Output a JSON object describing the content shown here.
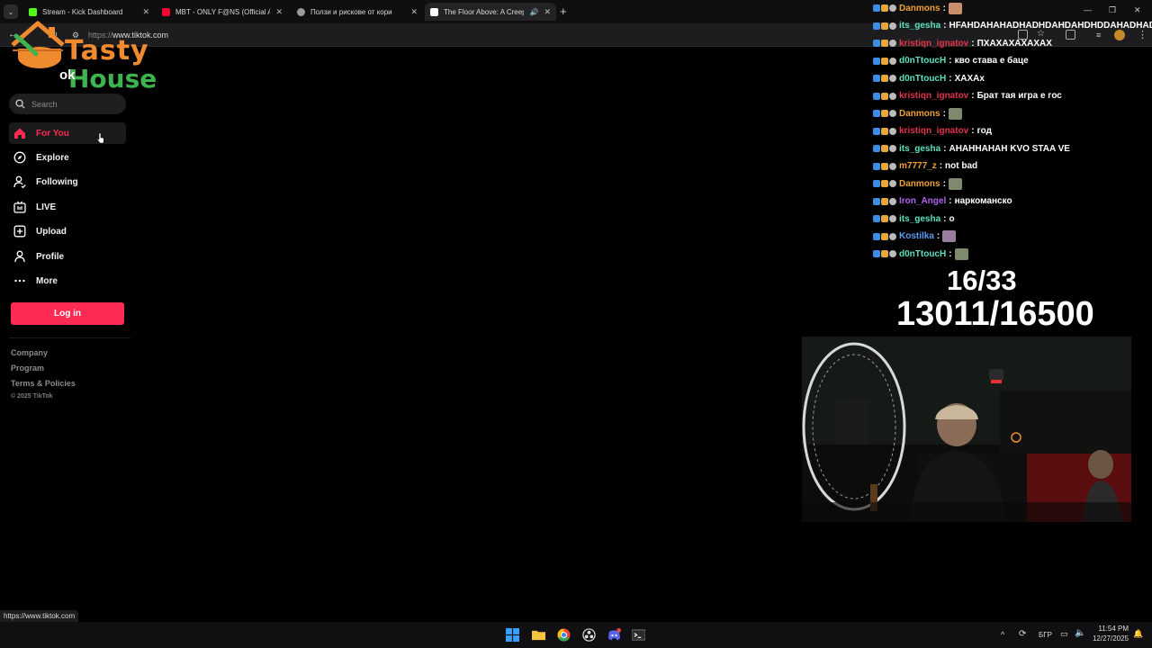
{
  "browser": {
    "tabs": [
      {
        "title": "Stream - Kick Dashboard",
        "favicon_color": "#53fc18",
        "active": false
      },
      {
        "title": "MBT - ONLY F@NS (Official Au",
        "favicon_color": "#ff0033",
        "active": false
      },
      {
        "title": "Ползи и рискове от кори",
        "favicon_color": "#9a9a9a",
        "active": false
      },
      {
        "title": "The Floor Above: A Creepy",
        "favicon_color": "#ffffff",
        "active": true
      }
    ],
    "url_protocol": "https://",
    "url_host": "www.tiktok.com",
    "status_url": "https://www.tiktok.com"
  },
  "overlay_logo": {
    "line1": "Tasty",
    "line2": "House",
    "partial_wordmark": "ok"
  },
  "sidebar": {
    "search_placeholder": "Search",
    "items": [
      {
        "label": "For You",
        "icon": "home-icon",
        "active": true
      },
      {
        "label": "Explore",
        "icon": "compass-icon",
        "active": false
      },
      {
        "label": "Following",
        "icon": "following-icon",
        "active": false
      },
      {
        "label": "LIVE",
        "icon": "live-icon",
        "active": false
      },
      {
        "label": "Upload",
        "icon": "upload-icon",
        "active": false
      },
      {
        "label": "Profile",
        "icon": "profile-icon",
        "active": false
      },
      {
        "label": "More",
        "icon": "more-icon",
        "active": false
      }
    ],
    "login_label": "Log in",
    "footer_links": [
      "Company",
      "Program",
      "Terms & Policies"
    ],
    "copyright": "© 2025 TikTok"
  },
  "chat": {
    "messages": [
      {
        "user": "Danmons",
        "color": "#f0a035",
        "text": "",
        "emote": true
      },
      {
        "user": "its_gesha",
        "color": "#5ce0c0",
        "text": "HFAHDAHAHADHADHDAHDAHDHDDAHADHADH",
        "emote": false
      },
      {
        "user": "kristiqn_ignatov",
        "color": "#e0344a",
        "text": "ПХАХАХАХАХАХ",
        "emote": false
      },
      {
        "user": "d0nTtoucH",
        "color": "#5ce0c0",
        "text": "кво става е баце",
        "emote": false
      },
      {
        "user": "d0nTtoucH",
        "color": "#5ce0c0",
        "text": "ХАХАх",
        "emote": false
      },
      {
        "user": "kristiqn_ignatov",
        "color": "#e0344a",
        "text": "Брат тая игра е гос",
        "emote": false
      },
      {
        "user": "Danmons",
        "color": "#f0a035",
        "text": "",
        "emote": true
      },
      {
        "user": "kristiqn_ignatov",
        "color": "#e0344a",
        "text": "год",
        "emote": false
      },
      {
        "user": "its_gesha",
        "color": "#5ce0c0",
        "text": "АНАННАНАН KVO STAA VE",
        "emote": false
      },
      {
        "user": "m7777_z",
        "color": "#f0a035",
        "text": "not bad",
        "emote": false
      },
      {
        "user": "Danmons",
        "color": "#f0a035",
        "text": "",
        "emote": true
      },
      {
        "user": "Iron_Angel",
        "color": "#b064f0",
        "text": "наркоманско",
        "emote": false
      },
      {
        "user": "its_gesha",
        "color": "#5ce0c0",
        "text": "o",
        "emote": false
      },
      {
        "user": "Kostilka",
        "color": "#5a9ef0",
        "text": "",
        "emote": true
      },
      {
        "user": "d0nTtoucH",
        "color": "#5ce0c0",
        "text": "",
        "emote": true
      }
    ]
  },
  "counters": {
    "line1": "16/33",
    "line2": "13011/16500"
  },
  "taskbar": {
    "language": "БГР",
    "time": "11:54 PM",
    "date": "12/27/2025"
  },
  "colors": {
    "tiktok_accent": "#fe2c55",
    "logo_orange": "#f08a2e",
    "logo_green": "#3fb34f"
  }
}
